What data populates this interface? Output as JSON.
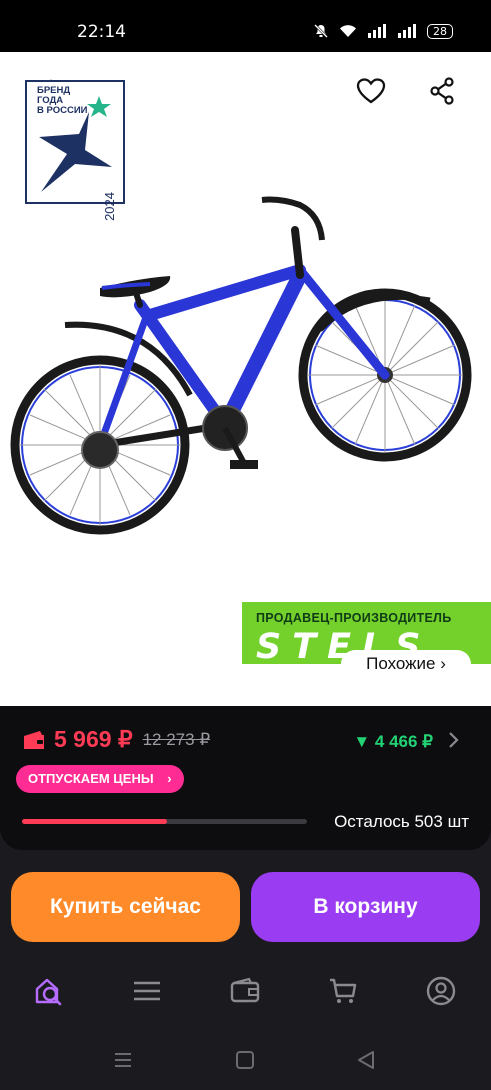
{
  "status_bar": {
    "time": "22:14",
    "battery": "28"
  },
  "product_image": {
    "brand_badge_lines": [
      "БРЕНД",
      "ГОДА",
      "В РОССИИ"
    ],
    "brand_badge_year": "2024",
    "seller_label": "ПРОДАВЕЦ-ПРОИЗВОДИТЕЛЬ",
    "seller_logo": "STELS",
    "similar_label": "Похожие ›"
  },
  "price": {
    "current": "5 969 ₽",
    "old": "12 273 ₽",
    "alternative": "▼ 4 466 ₽",
    "promo": "ОТПУСКАЕМ ЦЕНЫ",
    "stock_text": "Осталось 503 шт",
    "stock_progress": 0.51
  },
  "actions": {
    "buy": "Купить сейчас",
    "cart": "В корзину"
  },
  "colors": {
    "price": "#ff3b55",
    "alt_price": "#22d275",
    "promo": "#ff2d93",
    "buy": "#ff8a2a",
    "cart": "#9a3cf2",
    "active_tab": "#b56cff",
    "seller_banner": "#74d12c"
  },
  "tabs": [
    "home-search-icon",
    "catalog-icon",
    "wallet-icon",
    "cart-icon",
    "profile-icon"
  ]
}
